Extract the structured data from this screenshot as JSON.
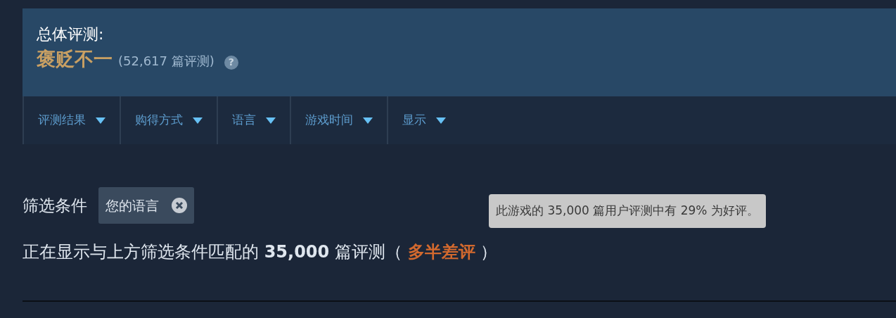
{
  "summary": {
    "title": "总体评测:",
    "rating": "褒贬不一",
    "color": "#c9a063",
    "count": "(52,617 篇评测)",
    "help": "?"
  },
  "filters": [
    {
      "label": "评测结果"
    },
    {
      "label": "购得方式"
    },
    {
      "label": "语言"
    },
    {
      "label": "游戏时间"
    },
    {
      "label": "显示"
    }
  ],
  "active_filters": {
    "label": "筛选条件",
    "chips": [
      {
        "label": "您的语言"
      }
    ]
  },
  "result": {
    "prefix": "正在显示与上方筛选条件匹配的",
    "count": "35,000",
    "suffix": "篇评测（",
    "rating": "多半差评",
    "color": "#d2692e",
    "close": "）"
  },
  "tooltip": {
    "text": "此游戏的 35,000 篇用户评测中有 29% 为好评。"
  }
}
